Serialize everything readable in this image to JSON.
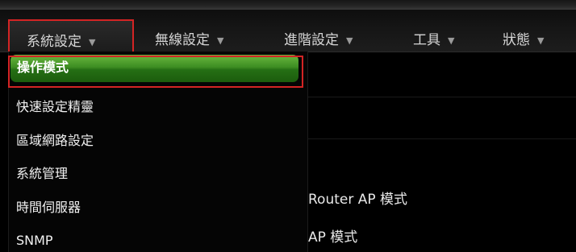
{
  "nav": {
    "items": [
      {
        "label": "系統設定",
        "chevron": "▼"
      },
      {
        "label": "無線設定",
        "chevron": "▼"
      },
      {
        "label": "進階設定",
        "chevron": "▼"
      },
      {
        "label": "工具",
        "chevron": "▼"
      },
      {
        "label": "狀態",
        "chevron": "▼"
      }
    ]
  },
  "dropdown": {
    "items": [
      {
        "label": "操作模式"
      },
      {
        "label": "快速設定精靈"
      },
      {
        "label": "區域網路設定"
      },
      {
        "label": "系統管理"
      },
      {
        "label": "時間伺服器"
      },
      {
        "label": "SNMP"
      }
    ],
    "selected_index": 0
  },
  "content": {
    "options": [
      {
        "label": "Router AP 模式"
      },
      {
        "label": "AP 模式"
      }
    ]
  },
  "colors": {
    "highlight_green": "#3d8d22",
    "annotation_red": "#d32424",
    "background": "#000000"
  }
}
